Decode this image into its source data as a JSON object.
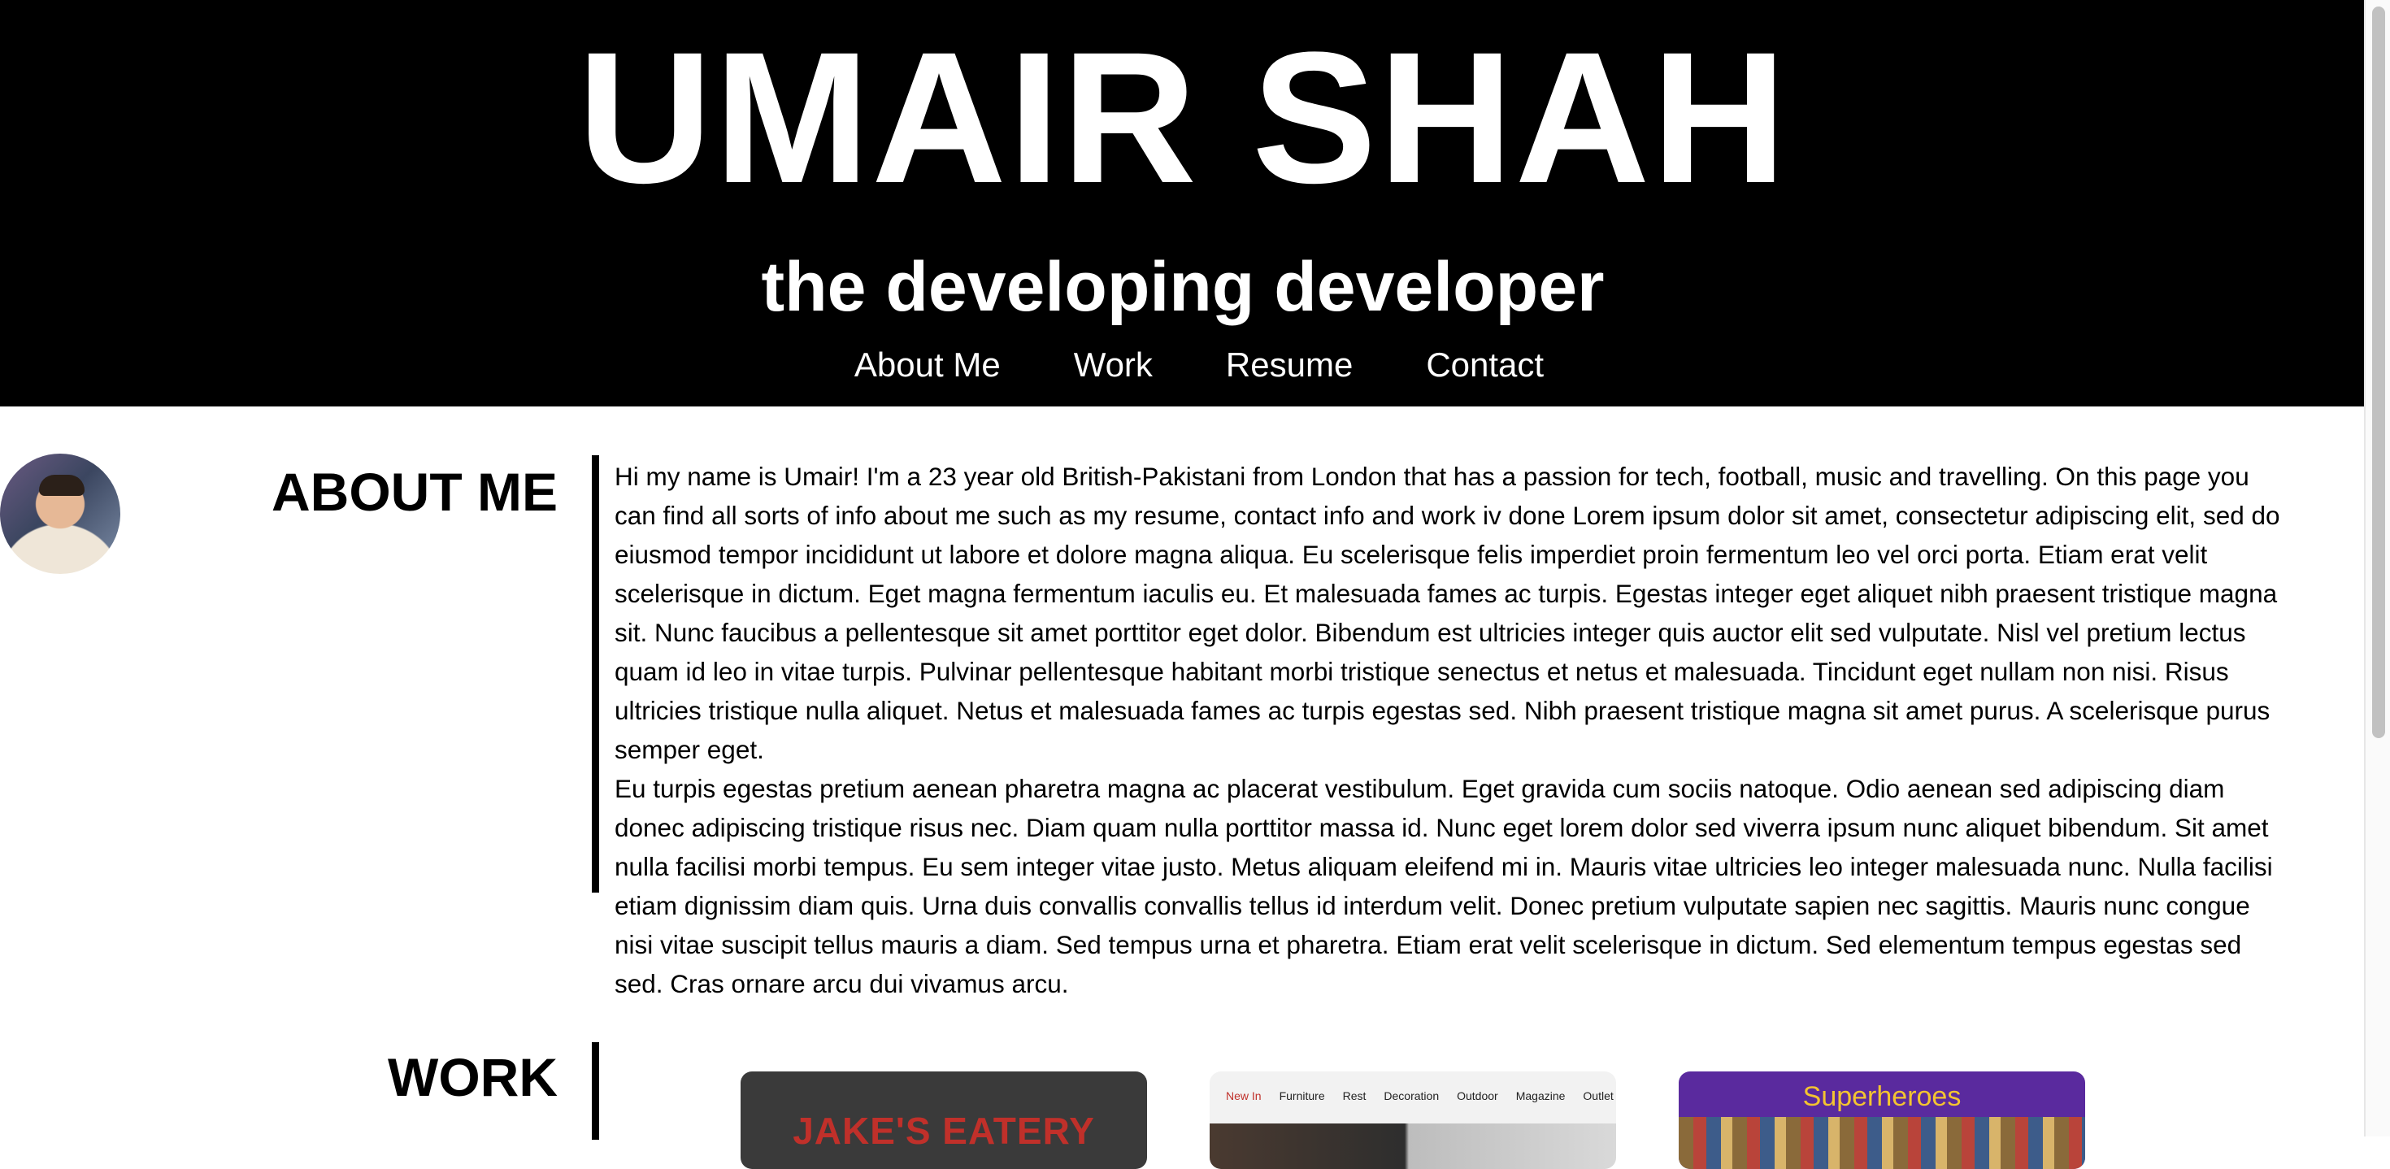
{
  "header": {
    "title": "UMAIR SHAH",
    "tagline": "the developing developer",
    "nav": [
      "About Me",
      "Work",
      "Resume",
      "Contact"
    ]
  },
  "about": {
    "heading": "ABOUT ME",
    "paragraphs": [
      "Hi my name is Umair! I'm a 23 year old British-Pakistani from London that has a passion for tech, football, music and travelling. On this page you can find all sorts of info about me such as my resume, contact info and work iv done Lorem ipsum dolor sit amet, consectetur adipiscing elit, sed do eiusmod tempor incididunt ut labore et dolore magna aliqua. Eu scelerisque felis imperdiet proin fermentum leo vel orci porta. Etiam erat velit scelerisque in dictum. Eget magna fermentum iaculis eu. Et malesuada fames ac turpis. Egestas integer eget aliquet nibh praesent tristique magna sit. Nunc faucibus a pellentesque sit amet porttitor eget dolor. Bibendum est ultricies integer quis auctor elit sed vulputate. Nisl vel pretium lectus quam id leo in vitae turpis. Pulvinar pellentesque habitant morbi tristique senectus et netus et malesuada. Tincidunt eget nullam non nisi. Risus ultricies tristique nulla aliquet. Netus et malesuada fames ac turpis egestas sed. Nibh praesent tristique magna sit amet purus. A scelerisque purus semper eget.",
      "Eu turpis egestas pretium aenean pharetra magna ac placerat vestibulum. Eget gravida cum sociis natoque. Odio aenean sed adipiscing diam donec adipiscing tristique risus nec. Diam quam nulla porttitor massa id. Nunc eget lorem dolor sed viverra ipsum nunc aliquet bibendum. Sit amet nulla facilisi morbi tempus. Eu sem integer vitae justo. Metus aliquam eleifend mi in. Mauris vitae ultricies leo integer malesuada nunc. Nulla facilisi etiam dignissim diam quis. Urna duis convallis convallis tellus id interdum velit. Donec pretium vulputate sapien nec sagittis. Mauris nunc congue nisi vitae suscipit tellus mauris a diam. Sed tempus urna et pharetra. Etiam erat velit scelerisque in dictum. Sed elementum tempus egestas sed sed. Cras ornare arcu dui vivamus arcu."
    ]
  },
  "work": {
    "heading": "WORK",
    "cards": [
      {
        "title": "JAKE'S EATERY"
      },
      {
        "nav": [
          "New In",
          "Furniture",
          "Rest",
          "Decoration",
          "Outdoor",
          "Magazine",
          "Outlet"
        ]
      },
      {
        "title": "Superheroes"
      }
    ]
  },
  "colors": {
    "header_bg": "#000000",
    "header_text": "#ffffff",
    "accent_red": "#c0302a",
    "superheroes_purple": "#5a2a9e",
    "superheroes_gold": "#f4c430"
  }
}
